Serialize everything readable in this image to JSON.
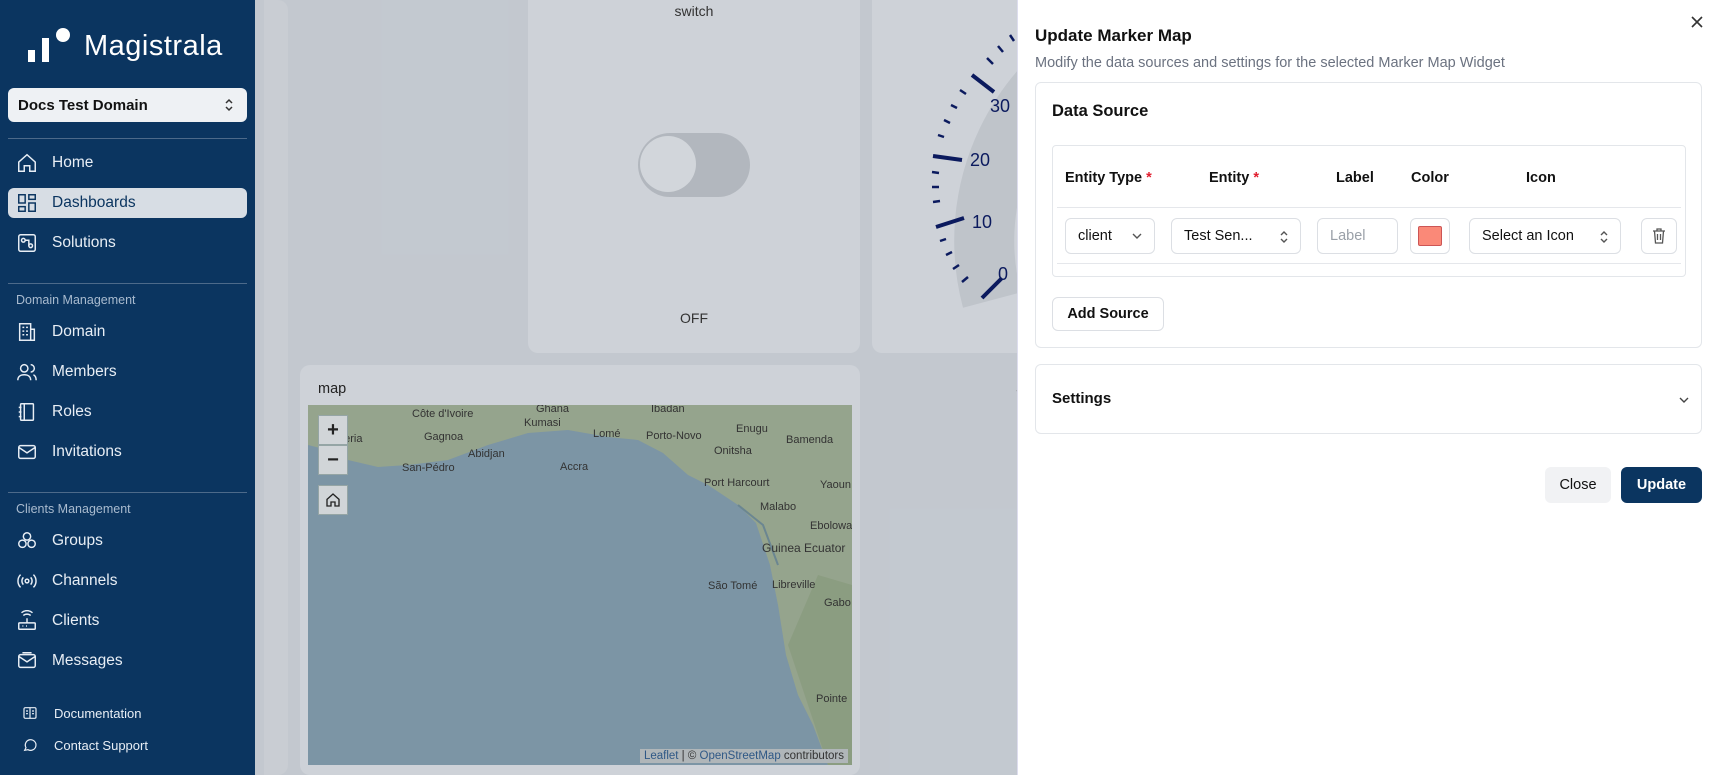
{
  "sidebar": {
    "brand": "Magistrala",
    "domain_selector": "Docs Test Domain",
    "nav": [
      {
        "label": "Home",
        "icon": "home-icon"
      },
      {
        "label": "Dashboards",
        "icon": "dashboard-icon",
        "active": true
      },
      {
        "label": "Solutions",
        "icon": "solutions-icon"
      }
    ],
    "domain_section": {
      "label": "Domain Management",
      "items": [
        {
          "label": "Domain",
          "icon": "building-icon"
        },
        {
          "label": "Members",
          "icon": "users-icon"
        },
        {
          "label": "Roles",
          "icon": "book-icon"
        },
        {
          "label": "Invitations",
          "icon": "mail-icon"
        }
      ]
    },
    "clients_section": {
      "label": "Clients Management",
      "items": [
        {
          "label": "Groups",
          "icon": "groups-icon"
        },
        {
          "label": "Channels",
          "icon": "channels-icon"
        },
        {
          "label": "Clients",
          "icon": "router-icon"
        },
        {
          "label": "Messages",
          "icon": "messages-icon"
        }
      ]
    },
    "footer": [
      {
        "label": "Documentation",
        "icon": "docs-icon"
      },
      {
        "label": "Contact Support",
        "icon": "chat-icon"
      }
    ]
  },
  "dashboard": {
    "switch_widget": {
      "title": "switch",
      "state_label": "OFF"
    },
    "gauge_widget": {
      "ticks": [
        "30",
        "20",
        "10",
        "0"
      ]
    },
    "map_widget": {
      "title": "map",
      "zoom_in": "+",
      "zoom_out": "−",
      "cities": [
        "Côte d'Ivoire",
        "Ghana",
        "Ibadan",
        "Kumasi",
        "Enugu",
        "beria",
        "Gagnoa",
        "Lomé",
        "Porto-Novo",
        "Bamenda",
        "Abidjan",
        "Onitsha",
        "San-Pédro",
        "Accra",
        "Port Harcourt",
        "Yaoun",
        "Malabo",
        "Ebolowa",
        "Guinea Ecuator",
        "São Tomé",
        "Libreville",
        "Gabo",
        "Pointe"
      ],
      "attribution": {
        "leaflet": "Leaflet",
        "separator": " | © ",
        "osm": "OpenStreetMap",
        "suffix": " contributors"
      }
    }
  },
  "panel": {
    "title": "Update Marker Map",
    "description": "Modify the data sources and settings for the selected Marker Map Widget",
    "data_source": {
      "title": "Data Source",
      "headers": {
        "entity_type": "Entity Type",
        "entity": "Entity",
        "label": "Label",
        "color": "Color",
        "icon": "Icon"
      },
      "required_mark": "*",
      "row": {
        "entity_type": "client",
        "entity": "Test Sen...",
        "label_placeholder": "Label",
        "color": "#fa8978",
        "icon_placeholder": "Select an Icon"
      },
      "add_source": "Add Source"
    },
    "settings": {
      "title": "Settings"
    },
    "buttons": {
      "close": "Close",
      "update": "Update"
    }
  },
  "colors": {
    "sidebar_bg": "#0b3560",
    "primary": "#0b3560",
    "required": "#e11d2e"
  }
}
